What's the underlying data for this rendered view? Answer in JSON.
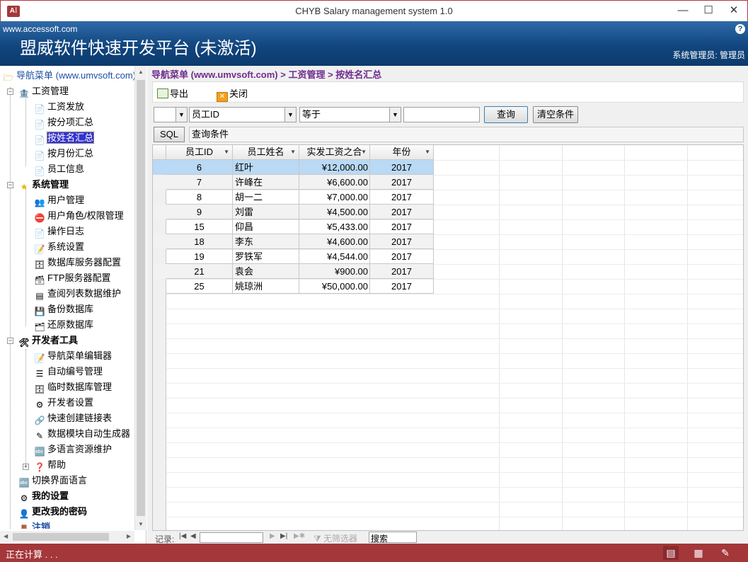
{
  "window": {
    "title": "CHYB Salary management system 1.0",
    "app_icon": "A⁞",
    "min": "—",
    "max": "☐",
    "close": "✕"
  },
  "banner": {
    "url": "www.accessoft.com",
    "title": "盟威软件快速开发平台 (未激活)",
    "user": "系统管理员: 管理员",
    "help": "?"
  },
  "tree": {
    "root": "导航菜单 (www.umvsoft.com)",
    "groups": [
      {
        "label": "工资管理",
        "items": [
          "工资发放",
          "按分项汇总",
          "按姓名汇总",
          "按月份汇总",
          "员工信息"
        ]
      },
      {
        "label": "系统管理",
        "items": [
          "用户管理",
          "用户角色/权限管理",
          "操作日志",
          "系统设置",
          "数据库服务器配置",
          "FTP服务器配置",
          "查阅列表数据维护",
          "备份数据库",
          "还原数据库"
        ]
      },
      {
        "label": "开发者工具",
        "items": [
          "导航菜单编辑器",
          "自动编号管理",
          "临时数据库管理",
          "开发者设置",
          "快速创建链接表",
          "数据模块自动生成器",
          "多语言资源维护",
          "帮助"
        ]
      }
    ],
    "bottom": [
      "切换界面语言",
      "我的设置",
      "更改我的密码",
      "注销"
    ],
    "selected": "按姓名汇总"
  },
  "breadcrumb": "导航菜单 (www.umvsoft.com) > 工资管理 > 按姓名汇总",
  "toolbar": {
    "export": "导出",
    "close": "关闭"
  },
  "filter": {
    "field": "员工ID",
    "operator": "等于",
    "value": "",
    "query": "查询",
    "clear": "清空条件"
  },
  "sql": {
    "button": "SQL",
    "label": "查询条件"
  },
  "grid": {
    "columns": [
      "员工ID",
      "员工姓名",
      "实发工资之合",
      "年份"
    ],
    "rows": [
      [
        "6",
        "红叶",
        "¥12,000.00",
        "2017"
      ],
      [
        "7",
        "许峰在",
        "¥6,600.00",
        "2017"
      ],
      [
        "8",
        "胡一二",
        "¥7,000.00",
        "2017"
      ],
      [
        "9",
        "刘雷",
        "¥4,500.00",
        "2017"
      ],
      [
        "15",
        "仰昌",
        "¥5,433.00",
        "2017"
      ],
      [
        "18",
        "李东",
        "¥4,600.00",
        "2017"
      ],
      [
        "19",
        "罗铁军",
        "¥4,544.00",
        "2017"
      ],
      [
        "21",
        "袁会",
        "¥900.00",
        "2017"
      ],
      [
        "25",
        "姚琼洲",
        "¥50,000.00",
        "2017"
      ]
    ]
  },
  "nav": {
    "record_label": "记录:",
    "nofilter": "无筛选器",
    "search": "搜索"
  },
  "status": {
    "text": "正在计算 . . ."
  },
  "colors": {
    "accent": "#a4373a",
    "banner": "#1e5494",
    "breadcrumb": "#6f2d8f",
    "selection": "#3333cc",
    "row_highlight": "#b9d9f5"
  }
}
